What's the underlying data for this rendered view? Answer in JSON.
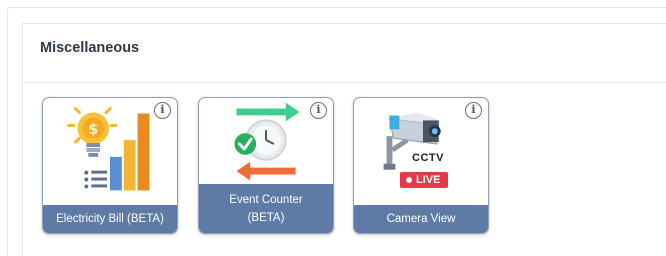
{
  "section": {
    "title": "Miscellaneous"
  },
  "cards": [
    {
      "label": "Electricity Bill (BETA)",
      "icon": "electricity-bill-icon",
      "info": "i"
    },
    {
      "label": "Event Counter (BETA)",
      "icon": "event-counter-icon",
      "info": "i"
    },
    {
      "label": "Camera View",
      "icon": "cctv-camera-icon",
      "info": "i",
      "badge_text": "CCTV",
      "live_text": "LIVE"
    }
  ],
  "colors": {
    "card_label_bg": "#5e7aa7",
    "card_border": "#8f9db5",
    "title": "#2d3a4a"
  }
}
